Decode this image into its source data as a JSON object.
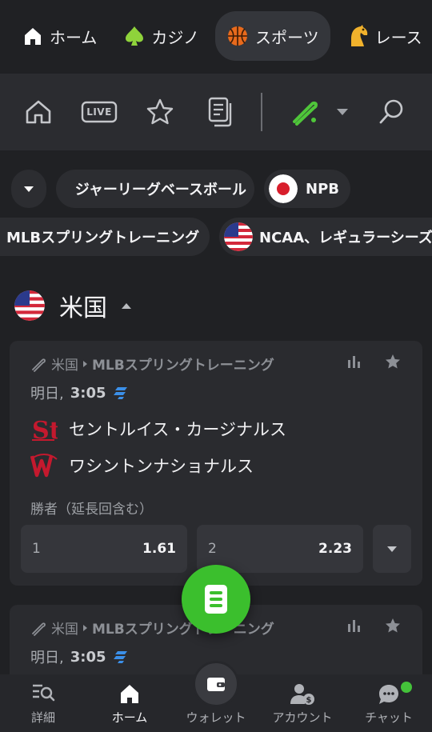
{
  "topnav": {
    "tabs": [
      {
        "label": "ホーム",
        "icon": "home-icon"
      },
      {
        "label": "カジノ",
        "icon": "spade-icon"
      },
      {
        "label": "スポーツ",
        "icon": "basketball-icon",
        "active": true
      },
      {
        "label": "レース",
        "icon": "horse-icon"
      }
    ]
  },
  "toolbar": {
    "live_label": "LIVE",
    "icons": [
      "home-icon",
      "live-icon",
      "star-icon",
      "betslip-list-icon",
      "baseball-bat-icon",
      "chevron-down-icon",
      "search-icon"
    ]
  },
  "chips": {
    "row1": [
      "ジャーリーグベースボール",
      "NPB"
    ],
    "row2": [
      "MLBスプリングトレーニング",
      "NCAA、レギュラーシーズン"
    ]
  },
  "country": {
    "name": "米国"
  },
  "cards": [
    {
      "country": "米国",
      "league": "MLBスプリングトレーニング",
      "day": "明日,",
      "time": "3:05",
      "team1": "セントルイス・カージナルス",
      "team2": "ワシントンナショナルス",
      "market": "勝者（延長回含む）",
      "odds": [
        {
          "label": "1",
          "value": "1.61"
        },
        {
          "label": "2",
          "value": "2.23"
        }
      ]
    },
    {
      "country": "米国",
      "league": "MLBスプリングトレーニング",
      "day": "明日,",
      "time": "3:05"
    }
  ],
  "bottomnav": {
    "items": [
      {
        "label": "詳細",
        "icon": "search-list-icon"
      },
      {
        "label": "ホーム",
        "icon": "home-icon",
        "active": true
      },
      {
        "label": "ウォレット",
        "icon": "wallet-icon"
      },
      {
        "label": "アカウント",
        "icon": "account-icon"
      },
      {
        "label": "チャット",
        "icon": "chat-icon"
      }
    ]
  },
  "colors": {
    "background": "#202124",
    "accent_green": "#3bbf2d",
    "card": "#2a2b2f",
    "live_blue": "#3b8fe8"
  }
}
